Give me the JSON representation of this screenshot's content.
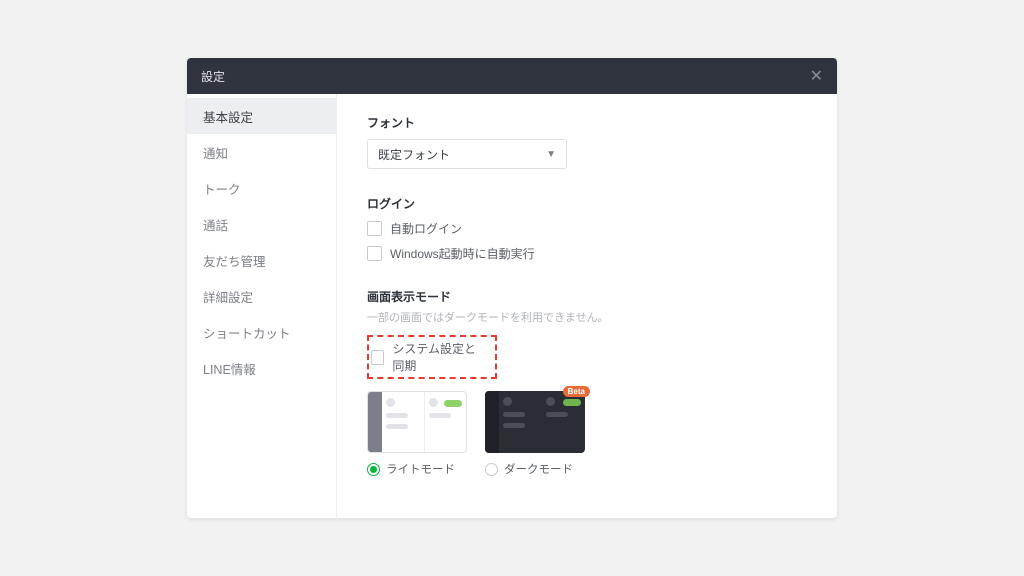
{
  "title": "設定",
  "sidebar": {
    "items": [
      {
        "label": "基本設定",
        "selected": true
      },
      {
        "label": "通知"
      },
      {
        "label": "トーク"
      },
      {
        "label": "通話"
      },
      {
        "label": "友だち管理"
      },
      {
        "label": "詳細設定"
      },
      {
        "label": "ショートカット"
      },
      {
        "label": "LINE情報"
      }
    ]
  },
  "main": {
    "font_label": "フォント",
    "font_value": "既定フォント",
    "login_label": "ログイン",
    "login_auto": "自動ログイン",
    "login_startup": "Windows起動時に自動実行",
    "display_label": "画面表示モード",
    "display_sub": "一部の画面ではダークモードを利用できません。",
    "display_sync": "システム設定と同期",
    "theme_light": "ライトモード",
    "theme_dark": "ダークモード",
    "beta_badge": "Beta"
  }
}
